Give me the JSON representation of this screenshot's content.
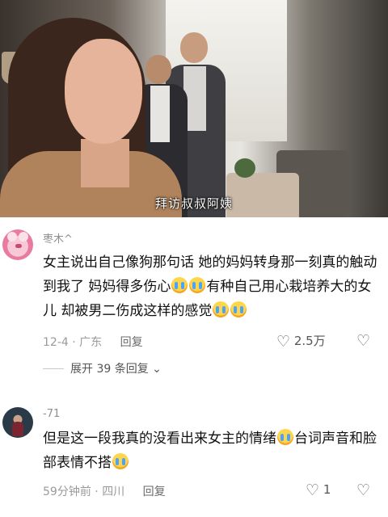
{
  "video": {
    "subtitle": "拜访叔叔阿姨"
  },
  "comments": [
    {
      "username": "枣木^",
      "text_parts": [
        "女主说出自己像狗那句话 她的妈妈转身那一刻真的触动到我了 妈妈得多伤心",
        "有种自己用心栽培养大的女儿 却被男二伤成这样的感觉"
      ],
      "date": "12-4",
      "location": "广东",
      "reply_label": "回复",
      "likes": "2.5万",
      "emoji": "loudly-crying-face"
    },
    {
      "username": "-71",
      "text_parts": [
        "但是这一段我真的没看出来女主的情绪",
        "台词声音和脸部表情不搭"
      ],
      "date": "59分钟前",
      "location": "四川",
      "reply_label": "回复",
      "likes": "1",
      "emoji": "loudly-crying-face"
    }
  ],
  "expand_replies": {
    "label": "展开 39 条回复"
  }
}
